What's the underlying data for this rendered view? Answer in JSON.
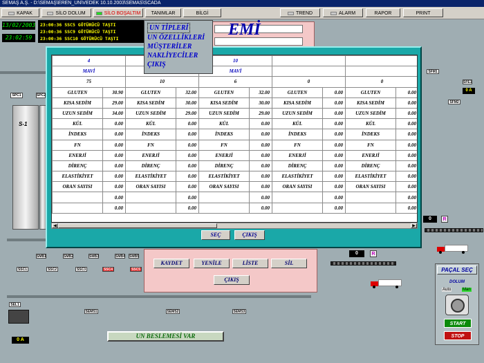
{
  "window_title": "SEMAŞ A.Ş. - D:\\SEMAŞ\\EREN_UN\\VEDEK 10.10.2003\\SEMAS\\SCADA",
  "menu": {
    "kapak": "KAPAK",
    "silo_dolum": "SİLO DOLUM",
    "silo_bosaltim": "SİLO BOŞALTIM",
    "tanimlar": "TANIMLAR",
    "bilgi": "BİLGİ",
    "trend": "TREND",
    "alarm": "ALARM",
    "rapor": "RAPOR",
    "print": "PRINT"
  },
  "clock": {
    "date": "13/02/2003",
    "time": "23:02:59"
  },
  "log_lines": [
    "23:00:36 SSC5 GÖTÜRÜCÜ TAŞTI",
    "23:00:36 SSC9 GÖTÜRÜCÜ TAŞTI",
    "23:00:36 SSC10 GÖTÜRÜCÜ TAŞTI"
  ],
  "bg_title": "EMİ",
  "popup_menu": [
    "UN TİPLERİ",
    "UN ÖZELLİKLERİ",
    "MÜŞTERİLER",
    "NAKLİYECİLER",
    "ÇIKIŞ"
  ],
  "grid": {
    "columns": [
      {
        "id": "4",
        "type": "MAVİ",
        "qty": "75",
        "values": [
          "30.90",
          "29.00",
          "34.00",
          "0.00",
          "0.00",
          "0.00",
          "0.00",
          "0.00",
          "0.00",
          "0.00",
          "0.00",
          "0.00"
        ]
      },
      {
        "id": "",
        "type": "",
        "qty": "10",
        "values": [
          "32.00",
          "30.00",
          "29.00",
          "0.00",
          "0.00",
          "0.00",
          "0.00",
          "0.00",
          "0.00",
          "0.00",
          "0.00",
          "0.00"
        ]
      },
      {
        "id": "10",
        "type": "MAVİ",
        "qty": "6",
        "values": [
          "32.00",
          "30.00",
          "29.00",
          "0.00",
          "0.00",
          "0.00",
          "0.00",
          "0.00",
          "0.00",
          "0.00",
          "0.00",
          "0.00"
        ]
      },
      {
        "id": "",
        "type": "",
        "qty": "0",
        "values": [
          "0.00",
          "0.00",
          "0.00",
          "0.00",
          "0.00",
          "0.00",
          "0.00",
          "0.00",
          "0.00",
          "0.00",
          "0.00",
          "0.00"
        ]
      },
      {
        "id": "",
        "type": "",
        "qty": "0",
        "values": [
          "0.00",
          "0.00",
          "0.00",
          "0.00",
          "0.00",
          "0.00",
          "0.00",
          "0.00",
          "0.00",
          "0.00",
          "0.00",
          "0.00"
        ]
      }
    ],
    "row_labels": [
      "GLUTEN",
      "KISA SEDİM",
      "UZUN SEDİM",
      "KÜL",
      "İNDEKS",
      "FN",
      "ENERJİ",
      "DİRENÇ",
      "ELASTİKİYET",
      "ORAN SAYISI",
      "",
      ""
    ]
  },
  "dialog_buttons": {
    "sec": "SEÇ",
    "cikis": "ÇIKIŞ"
  },
  "sub_buttons": {
    "kaydet": "KAYDET",
    "yenile": "YENİLE",
    "liste": "LİSTE",
    "sil": "SİL",
    "cikis": "ÇIKIŞ"
  },
  "banner": "UN BESLEMESİ VAR",
  "pacal": {
    "title": "PAÇAL SEÇ",
    "dolum": "DOLUM",
    "auto": "Auto",
    "man": "Man",
    "start": "START",
    "stop": "STOP"
  },
  "silo_label": "S-1",
  "bottom_left_readout": "0 A",
  "right_readout": "0 A",
  "mid_value_1": "0",
  "mid_value_2": "0",
  "r_tag": "R",
  "valve_tags": [
    "SMB1",
    "SMB2",
    "SMB3",
    "SMB4",
    "SMB5"
  ],
  "lower_tags": [
    "SSC1",
    "SSC2",
    "SSC3",
    "SSC4",
    "SSC5"
  ],
  "top_tags": [
    "SPC1",
    "SPC2"
  ],
  "right_tags": [
    "SFM1",
    "SFE1",
    "SFM2"
  ],
  "bottom_tags": [
    "SEL1",
    "SEMS1",
    "SEMS2",
    "SEMS3"
  ],
  "colors": {
    "dialog": "#1aa8a8",
    "title_blue": "#0000cc",
    "banner_green": "#0a6a0a"
  }
}
